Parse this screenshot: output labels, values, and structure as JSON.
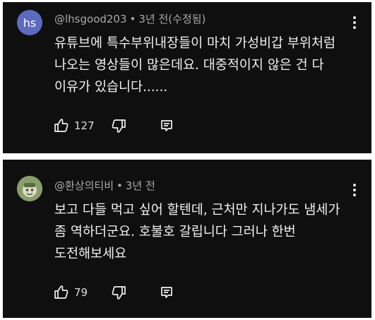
{
  "comments": [
    {
      "avatar_text": "hs",
      "author": "@lhsgood203",
      "separator": "•",
      "time": "3년 전(수정됨)",
      "lines": [
        "유튜브에 특수부위내장들이 마치 가성비갑 부위처럼",
        "나오는 영상들이 많은데요.  대중적이지 않은 건 다",
        "이유가 있습니다......"
      ],
      "likes": "127",
      "avatar_color": "#5c6bc0"
    },
    {
      "author": "@환상의티비",
      "separator": "•",
      "time": "3년 전",
      "lines": [
        "보고 다들 먹고 싶어 할텐데,  근처만 지나가도 냄세가",
        "좀 역하더군요. 호불호 갈립니다 그러나 한번",
        "도전해보세요"
      ],
      "likes": "79",
      "avatar_color": "#8a9e6b"
    }
  ],
  "icons": {
    "like": "thumb-up-icon",
    "dislike": "thumb-down-icon",
    "reply": "reply-icon",
    "menu": "more-vertical-icon"
  },
  "colors": {
    "card_background": "#0f0f0f",
    "text": "#f1f1f1",
    "meta": "#aaaaaa"
  }
}
